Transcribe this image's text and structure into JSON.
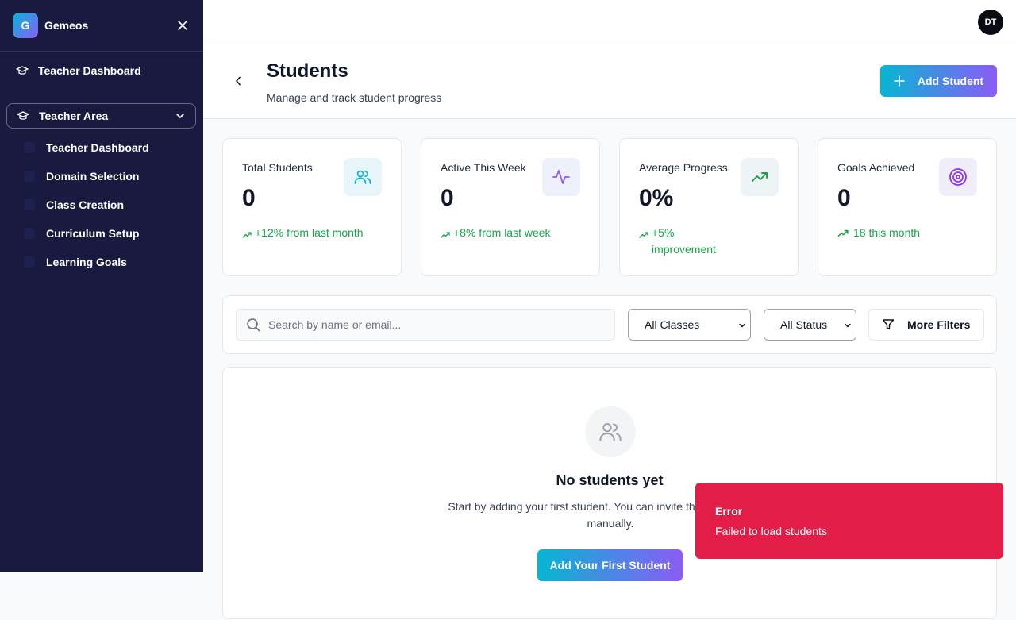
{
  "app": {
    "logo_letter": "G",
    "name": "Gemeos"
  },
  "sidebar": {
    "top_item": "Teacher Dashboard",
    "group": "Teacher Area",
    "sub_items": [
      "Teacher Dashboard",
      "Domain Selection",
      "Class Creation",
      "Curriculum Setup",
      "Learning Goals"
    ]
  },
  "user": {
    "initials": "DT"
  },
  "header": {
    "title": "Students",
    "subtitle": "Manage and track student progress",
    "add_button": "Add Student"
  },
  "stats": [
    {
      "label": "Total Students",
      "value": "0",
      "trend": "+12% from last month",
      "icon": "users-icon",
      "icon_color": "#06b6d4",
      "icon_bg": "#e8f6fb"
    },
    {
      "label": "Active This Week",
      "value": "0",
      "trend": "+8% from last week",
      "icon": "activity-icon",
      "icon_color": "#8b5cf6",
      "icon_bg": "#eef0fb"
    },
    {
      "label": "Average Progress",
      "value": "0%",
      "trend": "+5% improvement",
      "icon": "trending-up-icon",
      "icon_color": "#16a34a",
      "icon_bg": "#eef3f6"
    },
    {
      "label": "Goals Achieved",
      "value": "0",
      "trend": "18 this month",
      "icon": "target-icon",
      "icon_color": "#9333ea",
      "icon_bg": "#f0eefb"
    }
  ],
  "filters": {
    "search_placeholder": "Search by name or email...",
    "class_select": "All Classes",
    "status_select": "All Status",
    "more_filters": "More Filters"
  },
  "empty_state": {
    "title": "No students yet",
    "description": "Start by adding your first student. You can invite them or add them manually.",
    "button": "Add Your First Student"
  },
  "toast": {
    "title": "Error",
    "message": "Failed to load students",
    "color": "#e11d48"
  },
  "colors": {
    "sidebar_bg": "#1a1a40",
    "accent_start": "#06b6d4",
    "accent_end": "#8b5cf6",
    "positive": "#16a34a"
  }
}
